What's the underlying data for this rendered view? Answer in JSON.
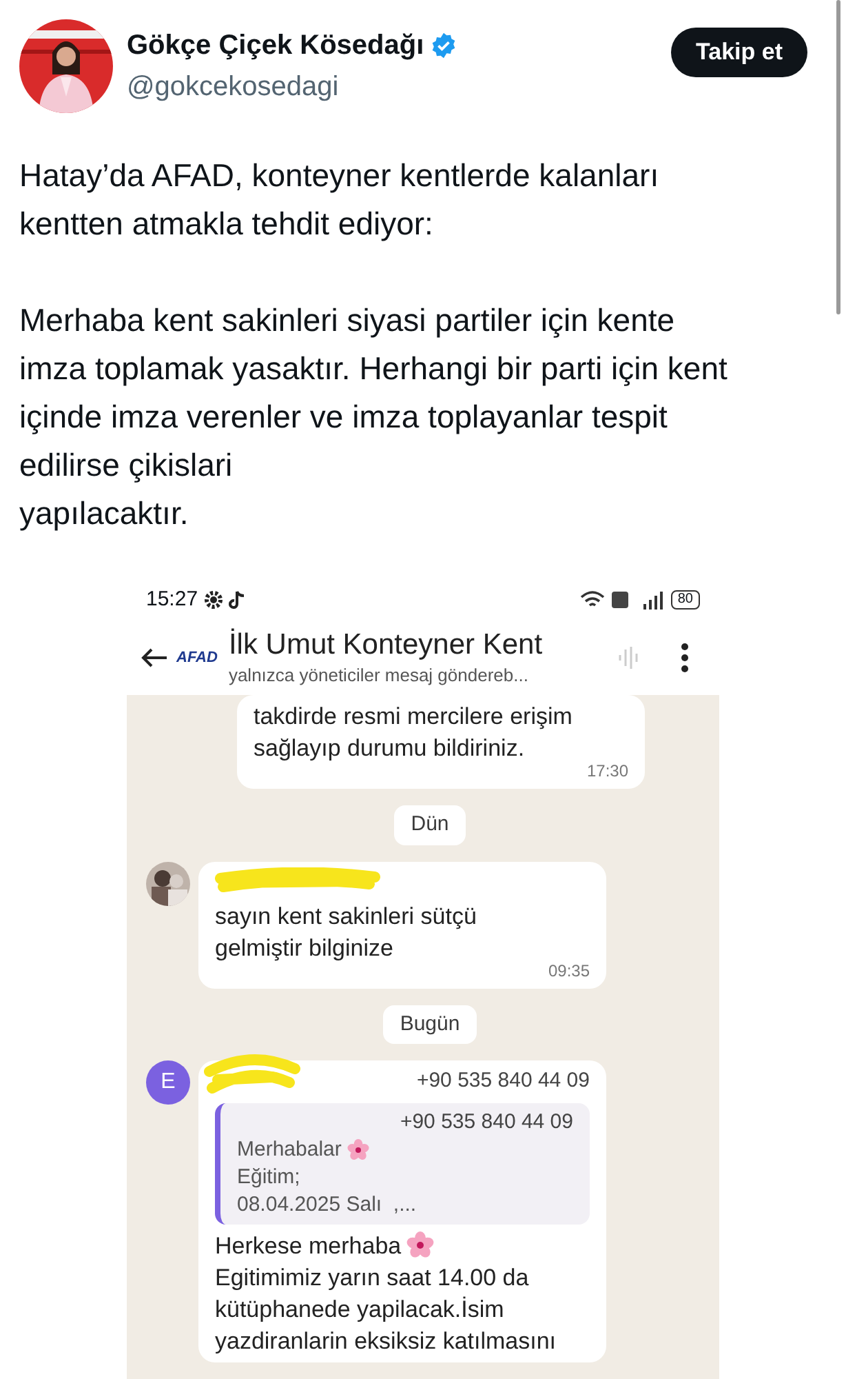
{
  "tweet": {
    "author": {
      "name": "Gökçe Çiçek Kösedağı",
      "verified": true,
      "handle": "@gokcekosedagi"
    },
    "follow_button": "Takip et",
    "text": [
      "Hatay’da AFAD, konteyner kentlerde kalanları kentten atmakla tehdit ediyor:",
      "Merhaba kent sakinleri siyasi partiler için kente imza toplamak yasaktır. Herhangi bir parti için kent içinde imza verenler ve imza toplayanlar tespit edilirse çikislari\nyapılacaktır."
    ]
  },
  "screenshot": {
    "status_bar": {
      "time": "15:27",
      "battery": "80"
    },
    "chat_header": {
      "logo": "AFAD",
      "title": "İlk Umut Konteyner Kent",
      "subtitle": "yalnızca yöneticiler mesaj göndereb..."
    },
    "messages": [
      {
        "kind": "message",
        "text": "takdirde resmi mercilere erişim\nsağlayıp durumu bildiriniz.",
        "time": "17:30"
      },
      {
        "kind": "date",
        "text": "Dün"
      },
      {
        "kind": "message",
        "redacted": true,
        "text": "sayın kent sakinleri sütçü\ngelmiştir bilginize",
        "time": "09:35"
      },
      {
        "kind": "date",
        "text": "Bugün"
      },
      {
        "kind": "forward",
        "avatar": {
          "kind": "letter",
          "letter": "E",
          "color": "#7b61e0"
        },
        "redacted": true,
        "phone": "+90 535 840 44 09",
        "quote": {
          "phone": "+90 535 840 44 09",
          "lines": [
            {
              "text": "Merhabalar",
              "flower": true
            },
            {
              "text": "Eğitim;",
              "flower": false
            },
            {
              "text": "08.04.2025 Salı  ,...",
              "flower": false
            }
          ]
        },
        "body": [
          {
            "text": "Herkese merhaba",
            "flower": true
          },
          {
            "text": "Egitimimiz yarın saat 14.00 da\nkütüphanede yapilacak.İsim\nyazdiranlarin eksiksiz katılmasını",
            "flower": false
          }
        ]
      }
    ]
  }
}
